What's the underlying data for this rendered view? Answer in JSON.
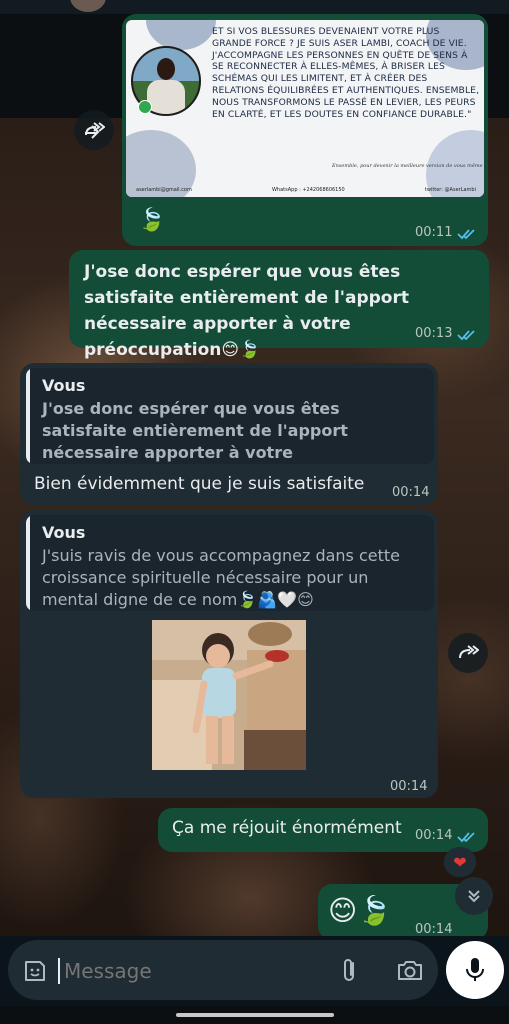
{
  "colors": {
    "outgoing_bubble": "#144d37",
    "incoming_bubble": "#1f2c34",
    "read_ticks": "#53bdeb",
    "background": "#0b141a"
  },
  "messages": [
    {
      "direction": "outgoing",
      "forwarded": true,
      "image_card": {
        "text": "ET SI VOS BLESSURES DEVENAIENT VOTRE PLUS GRANDE FORCE ? JE SUIS ASER LAMBI, COACH DE VIE. J'ACCOMPAGNE LES PERSONNES EN QUÊTE DE SENS À SE RECONNECTER À ELLES-MÊMES, À BRISER LES SCHÉMAS QUI LES LIMITENT, ET À CRÉER DES RELATIONS ÉQUILIBRÉES ET AUTHENTIQUES. ENSEMBLE, NOUS TRANSFORMONS LE PASSÉ EN LEVIER, LES PEURS EN CLARTÉ, ET LES DOUTES EN CONFIANCE DURABLE.\"",
        "tagline": "Ensemble, pour devenir la meilleure version de vous même",
        "email": "aserlambi@gmail.com",
        "whatsapp": "WhatsApp : +242068606150",
        "twitter": "twitter: @AserLambi"
      },
      "caption": "🍃",
      "time": "00:11",
      "status": "read"
    },
    {
      "direction": "outgoing",
      "text": "J'ose donc espérer que vous êtes satisfaite entièrement de l'apport nécessaire apporter à votre préoccupation😊🍃",
      "time": "00:13",
      "status": "read"
    },
    {
      "direction": "incoming",
      "quote": {
        "author": "Vous",
        "text": "J'ose donc espérer que vous êtes satisfaite entièrement de l'apport nécessaire apporter à votre préoccupation😊🍃"
      },
      "text": "Bien évidemment que je suis satisfaite",
      "time": "00:14"
    },
    {
      "direction": "incoming",
      "forwarded": true,
      "quote": {
        "author": "Vous",
        "text": "J'suis ravis de vous accompagnez dans cette croissance spirituelle nécessaire pour un mental digne de ce nom🍃🫂🤍😊"
      },
      "media": "gif",
      "time": "00:14"
    },
    {
      "direction": "outgoing",
      "text": "Ça me réjouit énormément",
      "time": "00:14",
      "status": "read",
      "reaction": "❤"
    },
    {
      "direction": "outgoing",
      "text": "😊🍃",
      "time": "00:14",
      "status": "read"
    }
  ],
  "composer": {
    "placeholder": "Message"
  }
}
